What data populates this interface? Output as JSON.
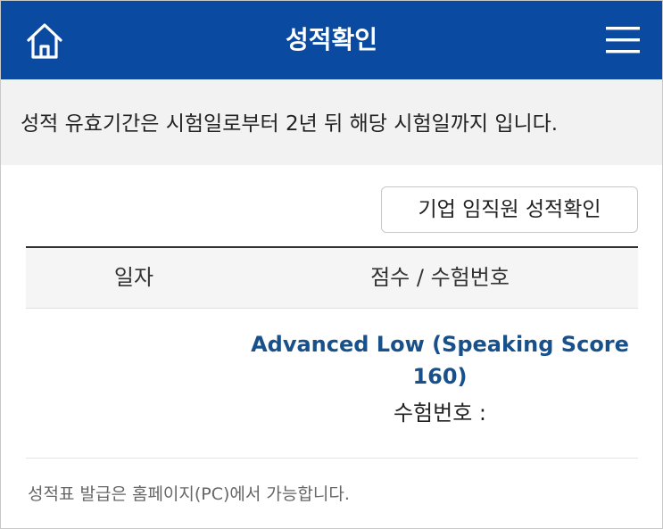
{
  "header": {
    "title": "성적확인",
    "home_icon": "home-icon",
    "menu_icon": "hamburger-menu-icon",
    "bg_color": "#0a4aa1"
  },
  "notice": {
    "text": "성적 유효기간은 시험일로부터 2년 뒤 해당 시험일까지 입니다."
  },
  "actions": {
    "corp_button_label": "기업 임직원 성적확인"
  },
  "table": {
    "columns": [
      "일자",
      "점수 / 수험번호"
    ],
    "rows": [
      {
        "date": "",
        "score": "Advanced Low (Speaking Score 160)",
        "exam_no_label": "수험번호 :",
        "exam_no_value": ""
      }
    ]
  },
  "footer": {
    "note": "성적표 발급은 홈페이지(PC)에서 가능합니다."
  }
}
